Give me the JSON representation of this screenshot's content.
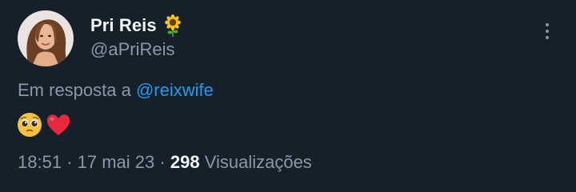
{
  "author": {
    "display_name": "Pri Reis",
    "badge_icon": "sunflower-icon",
    "handle": "@aPriReis",
    "avatar_icon": "avatar"
  },
  "reply": {
    "prefix": "Em resposta a",
    "mention": "@reixwife"
  },
  "body": {
    "emojis": [
      "pleading-face-icon",
      "red-heart-icon"
    ]
  },
  "meta": {
    "time": "18:51",
    "separator": "·",
    "date": "17 mai 23",
    "views_count": "298",
    "views_label": "Visualizações"
  },
  "colors": {
    "background": "#15202b",
    "text_primary": "#f7f9f9",
    "text_secondary": "#8b98a5",
    "link": "#1d9bf0"
  }
}
